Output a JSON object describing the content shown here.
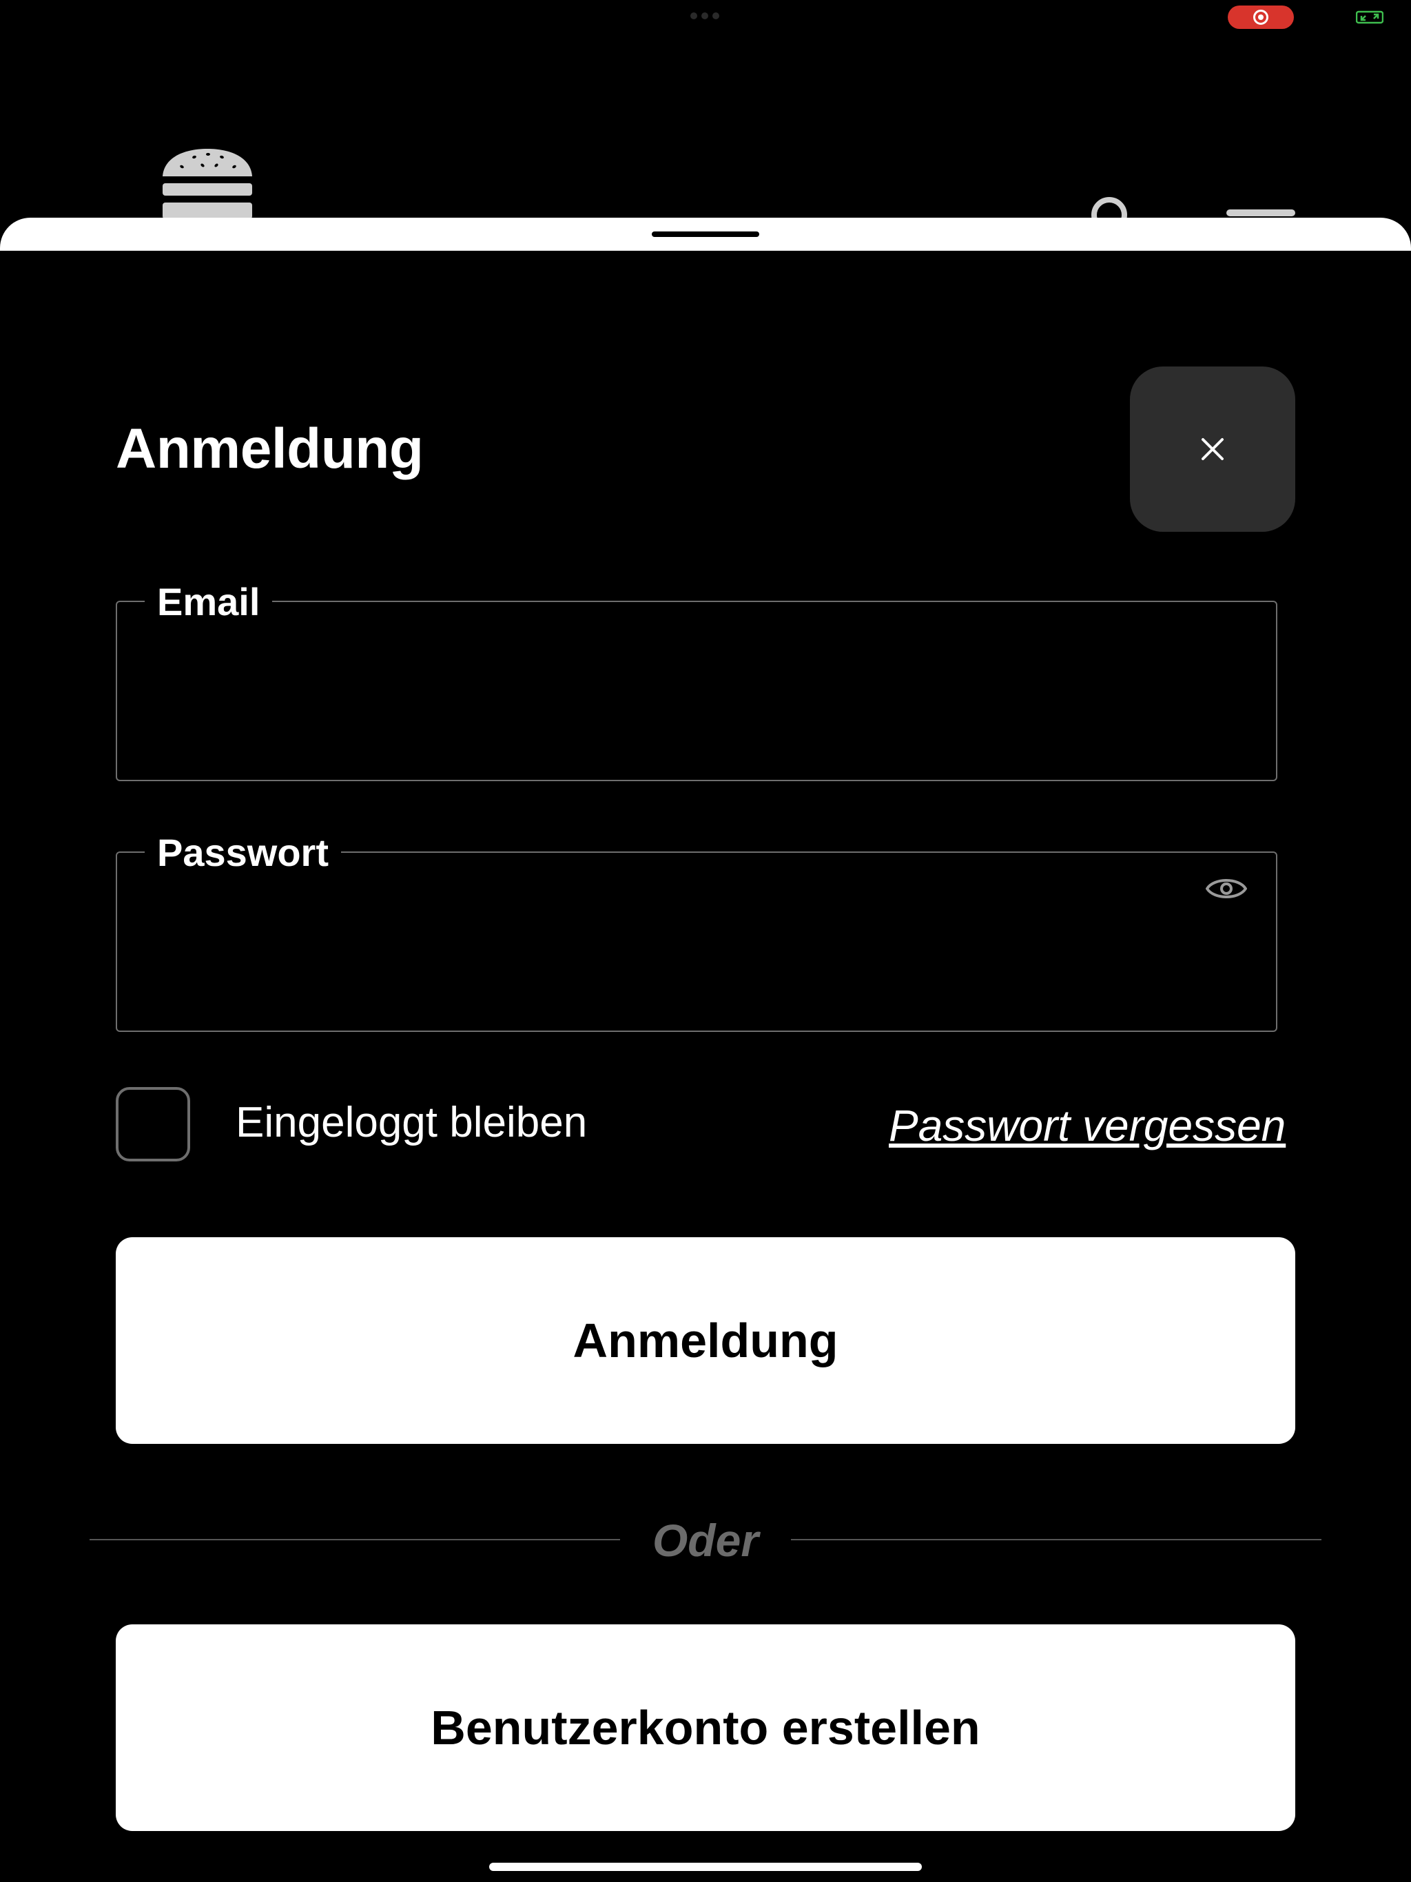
{
  "status_bar": {
    "multitask_icon": "ellipsis-icon",
    "recording_icon": "record-icon",
    "recording_color": "#d8342c",
    "screen_share_icon": "screen-share-icon",
    "screen_share_color": "#3fbf4f"
  },
  "background_header": {
    "logo_icon": "burger-logo-icon",
    "search_icon": "search-icon",
    "menu_icon": "menu-icon"
  },
  "sheet": {
    "title": "Anmeldung",
    "close_icon": "close-icon",
    "email": {
      "label": "Email",
      "value": "",
      "placeholder": ""
    },
    "password": {
      "label": "Passwort",
      "value": "",
      "placeholder": "",
      "toggle_icon": "eye-icon"
    },
    "remember_me": {
      "label": "Eingeloggt bleiben",
      "checked": false
    },
    "forgot_password": "Passwort vergessen",
    "login_button": "Anmeldung",
    "divider_text": "Oder",
    "register_button": "Benutzerkonto erstellen"
  }
}
